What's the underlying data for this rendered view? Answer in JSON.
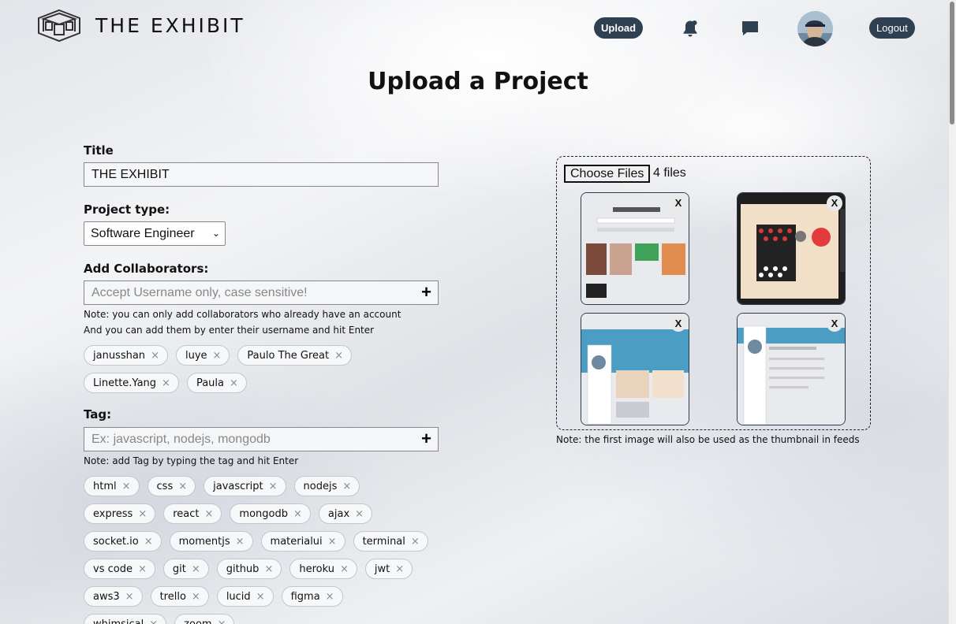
{
  "header": {
    "brand": "THE EXHIBIT",
    "upload_label": "Upload",
    "logout_label": "Logout"
  },
  "page_title": "Upload a Project",
  "form": {
    "title_label": "Title",
    "title_value": "THE EXHIBIT",
    "type_label": "Project type:",
    "type_value": "Software Engineer",
    "collab_label": "Add Collaborators:",
    "collab_placeholder": "Accept Username only, case sensitive!",
    "collab_note_1": "Note: you can only add collaborators who already have an account",
    "collab_note_2": "And you can add them by enter their username and hit Enter",
    "collaborators": [
      "janusshan",
      "luye",
      "Paulo The Great",
      "Linette.Yang",
      "Paula"
    ],
    "tag_label": "Tag:",
    "tag_placeholder": "Ex: javascript, nodejs, mongodb",
    "tag_note": "Note: add Tag by typing the tag and hit Enter",
    "tags": [
      "html",
      "css",
      "javascript",
      "nodejs",
      "express",
      "react",
      "mongodb",
      "ajax",
      "socket.io",
      "momentjs",
      "materialui",
      "terminal",
      "vs code",
      "git",
      "github",
      "heroku",
      "jwt",
      "aws3",
      "trello",
      "lucid",
      "figma",
      "whimsical",
      "zoom"
    ]
  },
  "upload": {
    "choose_label": "Choose Files",
    "file_count": "4 files",
    "remove_label": "X",
    "note": "Note: the first image will also be used as the thumbnail in feeds"
  },
  "icons": {
    "logo": "cube-logo-icon",
    "notifications": "bell-icon",
    "messages": "chat-icon",
    "remove_chip": "×",
    "add": "+"
  },
  "colors": {
    "pill_bg": "#2e4052",
    "border": "#888888"
  }
}
